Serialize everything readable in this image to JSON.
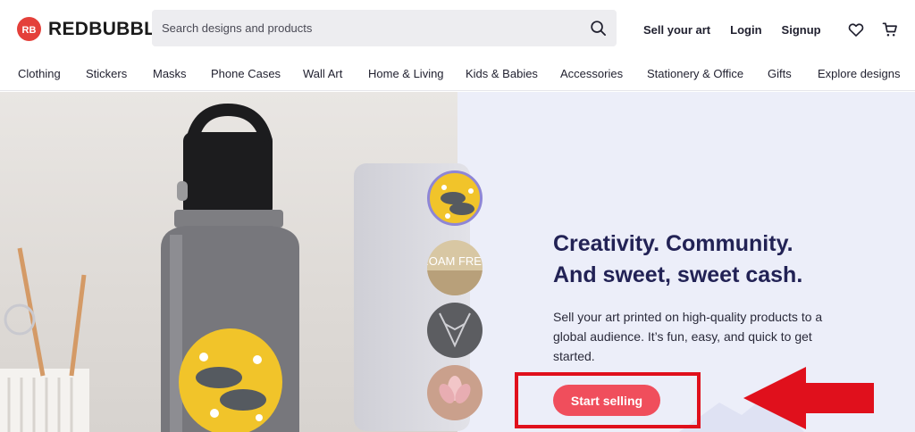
{
  "brand": {
    "name": "REDBUBBLE",
    "accent": "#e4403a"
  },
  "search": {
    "placeholder": "Search designs and products"
  },
  "top_links": {
    "sell": "Sell your art",
    "login": "Login",
    "signup": "Signup"
  },
  "nav": [
    "Clothing",
    "Stickers",
    "Masks",
    "Phone Cases",
    "Wall Art",
    "Home & Living",
    "Kids & Babies",
    "Accessories",
    "Stationery & Office",
    "Gifts",
    "Explore designs"
  ],
  "hero": {
    "headline_line1": "Creativity. Community.",
    "headline_line2": "And sweet, sweet cash.",
    "subtext": "Sell your art printed on high-quality products to a global audience. It’s fun, easy, and quick to get started.",
    "cta": "Start selling",
    "sticker_text": "ROAM FREE",
    "cta_color": "#f04e5c",
    "annotation_color": "#e0101c"
  }
}
